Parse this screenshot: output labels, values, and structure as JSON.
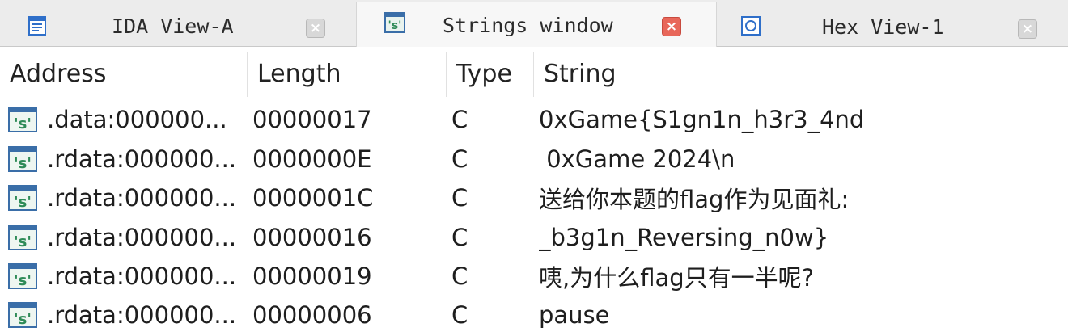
{
  "tabs": [
    {
      "title": "IDA View-A",
      "icon": "ida-view-icon",
      "active": false
    },
    {
      "title": "Strings window",
      "icon": "strings-icon",
      "active": true
    },
    {
      "title": "Hex View-1",
      "icon": "hex-view-icon",
      "active": false
    }
  ],
  "close_glyph": "×",
  "columns": {
    "address": "Address",
    "length": "Length",
    "type": "Type",
    "string": "String"
  },
  "rows": [
    {
      "address": ".data:000000...",
      "length": "00000017",
      "type": "C",
      "string": "0xGame{S1gn1n_h3r3_4nd"
    },
    {
      "address": ".rdata:000000...",
      "length": "0000000E",
      "type": "C",
      "string": " 0xGame 2024\\n"
    },
    {
      "address": ".rdata:000000...",
      "length": "0000001C",
      "type": "C",
      "string": "送给你本题的flag作为见面礼:"
    },
    {
      "address": ".rdata:000000...",
      "length": "00000016",
      "type": "C",
      "string": "_b3g1n_Reversing_n0w}"
    },
    {
      "address": ".rdata:000000...",
      "length": "00000019",
      "type": "C",
      "string": "咦,为什么flag只有一半呢?"
    },
    {
      "address": ".rdata:000000...",
      "length": "00000006",
      "type": "C",
      "string": "pause"
    }
  ],
  "row_icon": "string-s-icon",
  "row_icon_glyph": "'s'",
  "colors": {
    "active_close": "#e8675a",
    "icon_blue": "#2f6fc9",
    "icon_green": "#2e8b57"
  }
}
